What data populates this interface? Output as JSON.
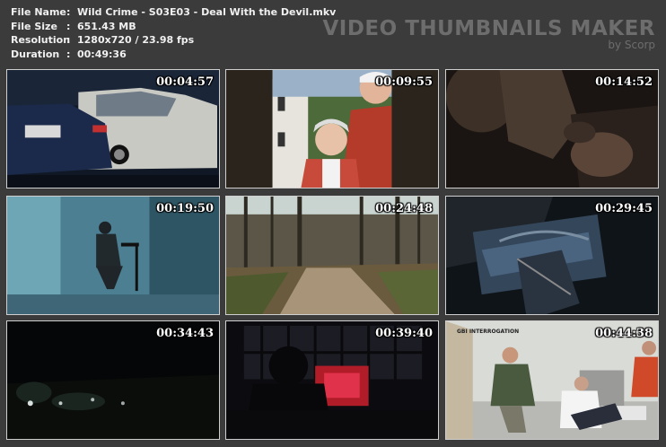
{
  "info": {
    "rows": [
      {
        "label": "File Name",
        "value": "Wild Crime - S03E03 - Deal With the Devil.mkv"
      },
      {
        "label": "File Size",
        "value": "651.43 MB"
      },
      {
        "label": "Resolution",
        "value": "1280x720 / 23.98 fps"
      },
      {
        "label": "Duration",
        "value": "00:49:36"
      }
    ],
    "separator": ":"
  },
  "brand": {
    "title": "VIDEO THUMBNAILS MAKER",
    "subtitle": "by Scorp"
  },
  "thumbnails": [
    {
      "timestamp": "00:04:57",
      "scene": "police-cars-night"
    },
    {
      "timestamp": "00:09:55",
      "scene": "elderly-couple-photo"
    },
    {
      "timestamp": "00:14:52",
      "scene": "dark-closeup-hands"
    },
    {
      "timestamp": "00:19:50",
      "scene": "man-sitting-blue-room"
    },
    {
      "timestamp": "00:24:48",
      "scene": "forest-dirt-road"
    },
    {
      "timestamp": "00:29:45",
      "scene": "handcuffed-hands"
    },
    {
      "timestamp": "00:34:43",
      "scene": "night-trees-lights"
    },
    {
      "timestamp": "00:39:40",
      "scene": "silhouette-red-window"
    },
    {
      "timestamp": "00:44:38",
      "scene": "interrogation-room",
      "overlay": "GBI INTERROGATION"
    }
  ]
}
